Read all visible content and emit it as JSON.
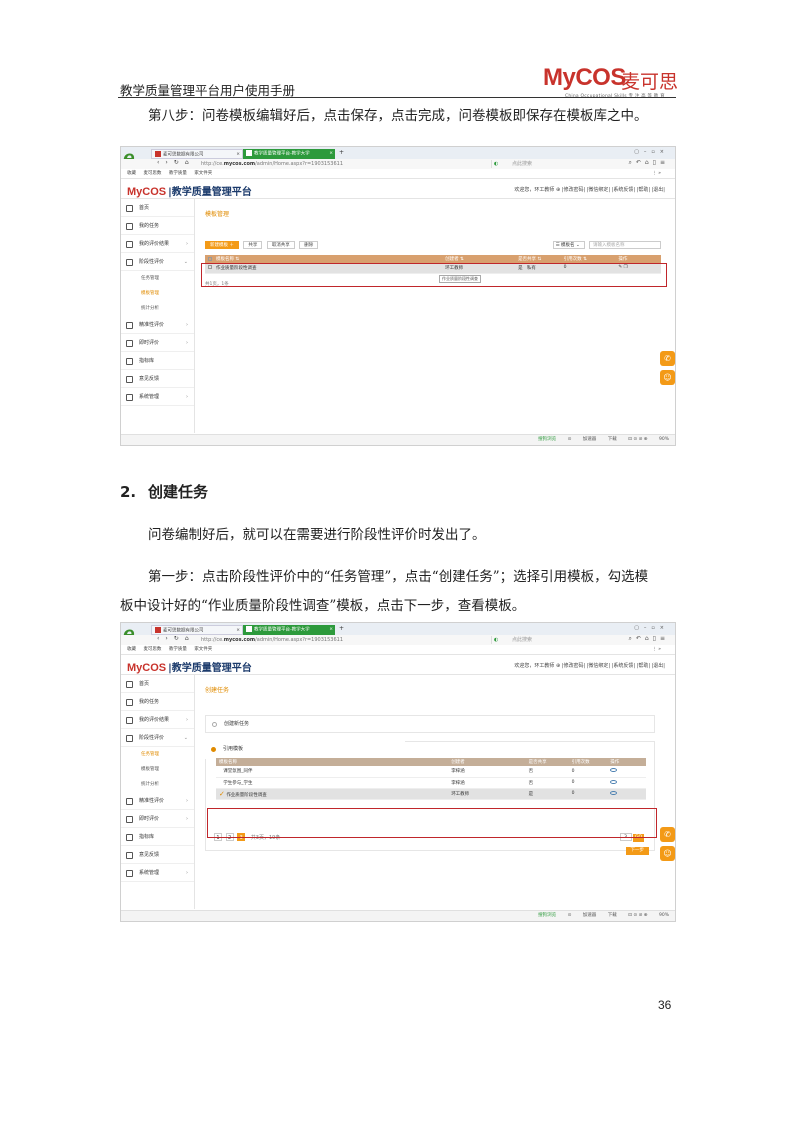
{
  "header": {
    "title": "教学质量管理平台用户使用手册",
    "logo_text": "MyCOS",
    "logo_cn": "麦可思",
    "logo_sub": "China Occupational Skills 专 注 高 等 教 育"
  },
  "paragraphs": {
    "p1": "第八步：问卷模板编辑好后，点击保存，点击完成，问卷模板即保存在模板库之中。",
    "section_num": "2.",
    "section_title": "创建任务",
    "p2": "问卷编制好后，就可以在需要进行阶段性评价时发出了。",
    "p3_line1": "第一步：点击阶段性评价中的“任务管理”，点击“创建任务”；选择引用模板，勾选模",
    "p3_line2": "板中设计好的“作业质量阶段性调查”模板，点击下一步，查看模板。"
  },
  "page_number": "36",
  "browser": {
    "tab1": "麦可思数据有限公司",
    "tab2": "教学质量管理平台-教学大学",
    "url_prefix": "http://ce.",
    "url_host": "mycos.com",
    "url_path": "/admin/Home.aspx?r=1903153611",
    "search_placeholder": "点此搜索",
    "bookmarks": [
      "收藏",
      "麦可思数",
      "教学质量",
      "家文件夹"
    ],
    "status_items": [
      "搜狗浏览",
      "加速器",
      "下载",
      "90%"
    ]
  },
  "app": {
    "logo_my": "MyCOS",
    "platform_name": "|教学质量管理平台",
    "user_bar": "欢迎您，环工教师 ⊕  |修改密码|  |微信绑定|  |系统反馈|  |帮助|  |退出|"
  },
  "sidebar": {
    "items": [
      {
        "label": "首页"
      },
      {
        "label": "我的任务"
      },
      {
        "label": "我的评价结果"
      },
      {
        "label": "阶段性评价"
      },
      {
        "label": "精准性评价"
      },
      {
        "label": "即时评价"
      },
      {
        "label": "指标库"
      },
      {
        "label": "意见反馈"
      },
      {
        "label": "系统管理"
      }
    ],
    "subitems": [
      "任务管理",
      "模板管理",
      "统计分析"
    ]
  },
  "shot1": {
    "breadcrumb": "模板管理",
    "toolbar": [
      "新建模板 ＋",
      "共享",
      "取消共享",
      "删除"
    ],
    "filter_select": "模板名",
    "filter_placeholder": "请输入模板名称",
    "columns": [
      "模板名称 ⇅",
      "创建者 ⇅",
      "是否共享 ⇅",
      "引用次数 ⇅",
      "操作"
    ],
    "row": {
      "name": "作业质量阶段性调查",
      "creator": "环工教师",
      "shared": "是",
      "extra": "私有",
      "count": "0"
    },
    "pager": "共1页，1条",
    "tooltip": "作业质量阶段性调查"
  },
  "shot2": {
    "breadcrumb": "创建任务",
    "option_new": "创建新任务",
    "option_ref": "引用模板",
    "columns": [
      "模板名称",
      "创建者",
      "是否共享",
      "引用次数",
      "操作"
    ],
    "rows": [
      {
        "name": "课堂氛围_同伴",
        "creator": "李梓涵",
        "shared": "否",
        "count": "0"
      },
      {
        "name": "学生参与_学生",
        "creator": "李梓涵",
        "shared": "否",
        "count": "0"
      },
      {
        "name": "作业质量阶段性调查",
        "creator": "环工教师",
        "shared": "是",
        "count": "0"
      }
    ],
    "pages": [
      "1",
      "2",
      "3"
    ],
    "count_text": "共3页，19条",
    "goto_value": "3",
    "goto_btn": "GO",
    "next_btn": "下一步"
  }
}
